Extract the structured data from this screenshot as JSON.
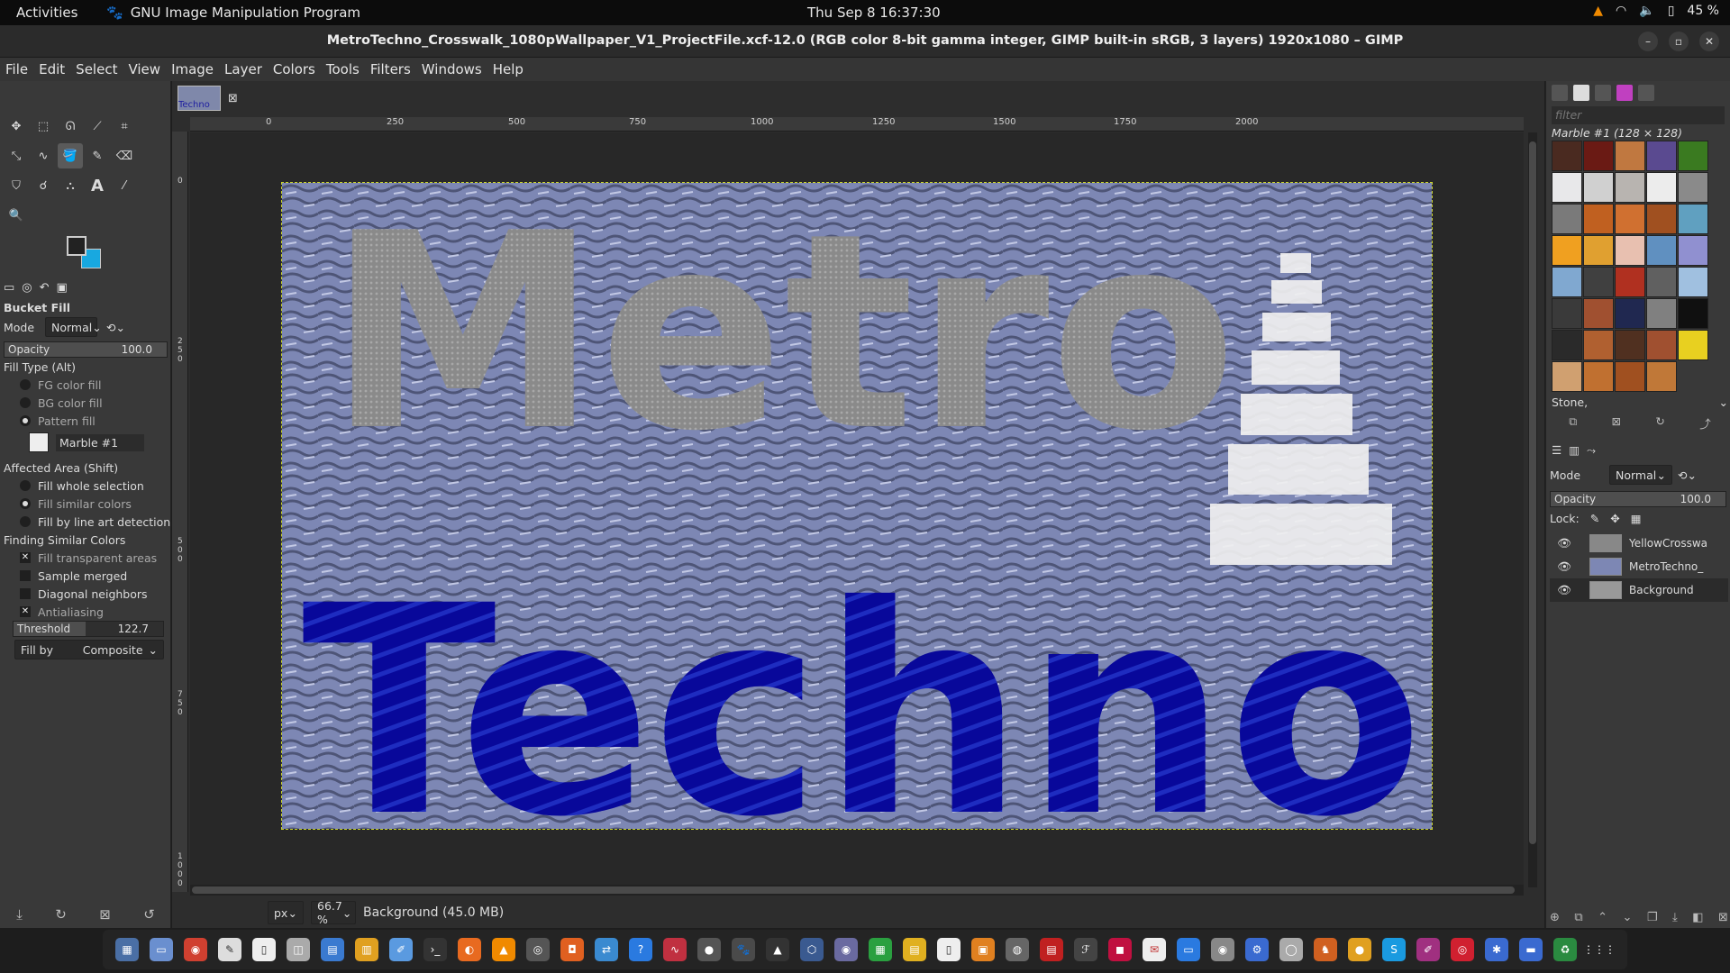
{
  "topbar": {
    "activities": "Activities",
    "app_name": "GNU Image Manipulation Program",
    "clock": "Thu Sep 8  16:37:30",
    "battery": "45 %"
  },
  "window": {
    "title": "MetroTechno_Crosswalk_1080pWallpaper_V1_ProjectFile.xcf-12.0 (RGB color 8-bit gamma integer, GIMP built-in sRGB, 3 layers) 1920x1080 – GIMP"
  },
  "menu": [
    "File",
    "Edit",
    "Select",
    "View",
    "Image",
    "Layer",
    "Colors",
    "Tools",
    "Filters",
    "Windows",
    "Help"
  ],
  "image_tab": {
    "label": "Techno"
  },
  "tool_options": {
    "title": "Bucket Fill",
    "mode_label": "Mode",
    "mode_value": "Normal",
    "opacity_label": "Opacity",
    "opacity_value": "100.0",
    "fill_type_label": "Fill Type  (Alt)",
    "fill_types": [
      "FG color fill",
      "BG color fill",
      "Pattern fill"
    ],
    "pattern_name": "Marble #1",
    "affected_label": "Affected Area  (Shift)",
    "affected": [
      "Fill whole selection",
      "Fill similar colors",
      "Fill by line art detection"
    ],
    "finding_label": "Finding Similar Colors",
    "finding": [
      "Fill transparent areas",
      "Sample merged",
      "Diagonal neighbors",
      "Antialiasing"
    ],
    "threshold_label": "Threshold",
    "threshold_value": "122.7",
    "fillby_label": "Fill by",
    "fillby_value": "Composite"
  },
  "rulers": {
    "h": [
      "0",
      "250",
      "500",
      "750",
      "1000",
      "1250",
      "1500",
      "1750",
      "2000"
    ],
    "v": [
      "0",
      "2 5 0",
      "5 0 0",
      "7 5 0",
      "1 0 0 0"
    ]
  },
  "artwork": {
    "word_top": "Metro",
    "word_bottom": "Techno",
    "color_bg": "#7d87b4",
    "color_top_text": "#8a8a8a",
    "color_bottom_text": "#08089a",
    "color_stripes": "#f0f0f0"
  },
  "status": {
    "unit": "px",
    "zoom": "66.7 %",
    "info": "Background (45.0 MB)"
  },
  "patterns": {
    "filter_placeholder": "filter",
    "selected": "Marble #1 (128 × 128)",
    "tag": "Stone,",
    "swatch_colors": [
      "#4a2a20",
      "#6a1a14",
      "#c07840",
      "#5a4a90",
      "#3a7a20",
      "#e8e8ea",
      "#d0d0d0",
      "#b8b4b0",
      "#ececec",
      "#8a8a8a",
      "#7a7a7a",
      "#c06020",
      "#d07030",
      "#a05020",
      "#60a0c0",
      "#f0a020",
      "#e0a030",
      "#e8c0b0",
      "#6090c0",
      "#9090d0",
      "#80a8d0",
      "#404040",
      "#b03020",
      "#606060",
      "#a0c0e0",
      "#3a3a3a",
      "#a05030",
      "#202850",
      "#808080",
      "#101010",
      "#2a2a2a",
      "#b06030",
      "#503020",
      "#a05030",
      "#e8d020",
      "#d0a070",
      "#c07030",
      "#a05020",
      "#c07838"
    ]
  },
  "layers": {
    "mode_label": "Mode",
    "mode_value": "Normal",
    "opacity_label": "Opacity",
    "opacity_value": "100.0",
    "lock_label": "Lock:",
    "items": [
      "YellowCrosswa",
      "MetroTechno_",
      "Background"
    ]
  }
}
